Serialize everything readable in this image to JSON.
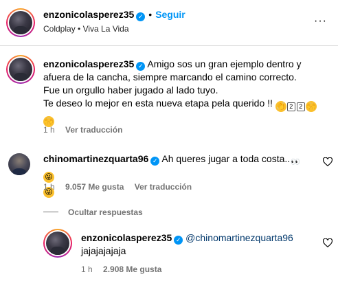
{
  "header": {
    "username": "enzonicolasperez35",
    "dot": "•",
    "follow_label": "Seguir",
    "music": "Coldplay • Viva La Vida",
    "more": "···"
  },
  "post": {
    "username": "enzonicolasperez35",
    "caption_lines": [
      "Amigo sos un gran ejemplo dentro y",
      "afuera de la cancha, siempre marcando el camino correcto.",
      "Fue un orgullo haber jugado al lado tuyo.",
      "Te deseo lo mejor en esta nueva etapa pela querido !!"
    ],
    "emoji_box_1": "2",
    "emoji_box_2": "2",
    "time": "1 h",
    "translate": "Ver traducción"
  },
  "comment": {
    "username": "chinomartinezquarta96",
    "text": "Ah queres jugar a toda costa..",
    "time": "1 h",
    "likes": "9.057 Me gusta",
    "translate": "Ver traducción"
  },
  "replies_toggle": "Ocultar respuestas",
  "reply": {
    "username": "enzonicolasperez35",
    "mention": "@chinomartinezquarta96",
    "text": "jajajajajaja",
    "time": "1 h",
    "likes": "2.908 Me gusta"
  },
  "colors": {
    "accent": "#0095f6",
    "mention": "#00376b",
    "meta": "#737373"
  }
}
